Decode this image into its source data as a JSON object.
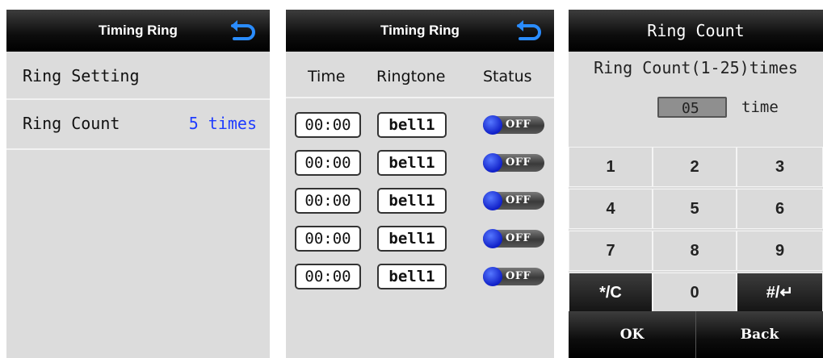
{
  "colors": {
    "accent_value": "#1f3cff",
    "panel_bg": "#dcdcdc",
    "titlebar_bg": "#000000",
    "toggle_knob": "#1020c8"
  },
  "panel1": {
    "title": "Timing Ring",
    "back_icon": "back-arrow-icon",
    "rows": [
      {
        "label": "Ring Setting",
        "value": ""
      },
      {
        "label": "Ring Count",
        "value": "5 times"
      }
    ]
  },
  "panel2": {
    "title": "Timing Ring",
    "back_icon": "back-arrow-icon",
    "headers": {
      "time": "Time",
      "ringtone": "Ringtone",
      "status": "Status"
    },
    "rows": [
      {
        "time": "00:00",
        "ringtone": "bell1",
        "status": "OFF"
      },
      {
        "time": "00:00",
        "ringtone": "bell1",
        "status": "OFF"
      },
      {
        "time": "00:00",
        "ringtone": "bell1",
        "status": "OFF"
      },
      {
        "time": "00:00",
        "ringtone": "bell1",
        "status": "OFF"
      },
      {
        "time": "00:00",
        "ringtone": "bell1",
        "status": "OFF"
      }
    ]
  },
  "panel3": {
    "title": "Ring Count",
    "label": "Ring Count(1-25)times",
    "input_value": "05",
    "unit": "time",
    "keys": [
      "1",
      "2",
      "3",
      "4",
      "5",
      "6",
      "7",
      "8",
      "9",
      "*/C",
      "0",
      "#/↵"
    ],
    "ok_label": "OK",
    "back_label": "Back"
  }
}
